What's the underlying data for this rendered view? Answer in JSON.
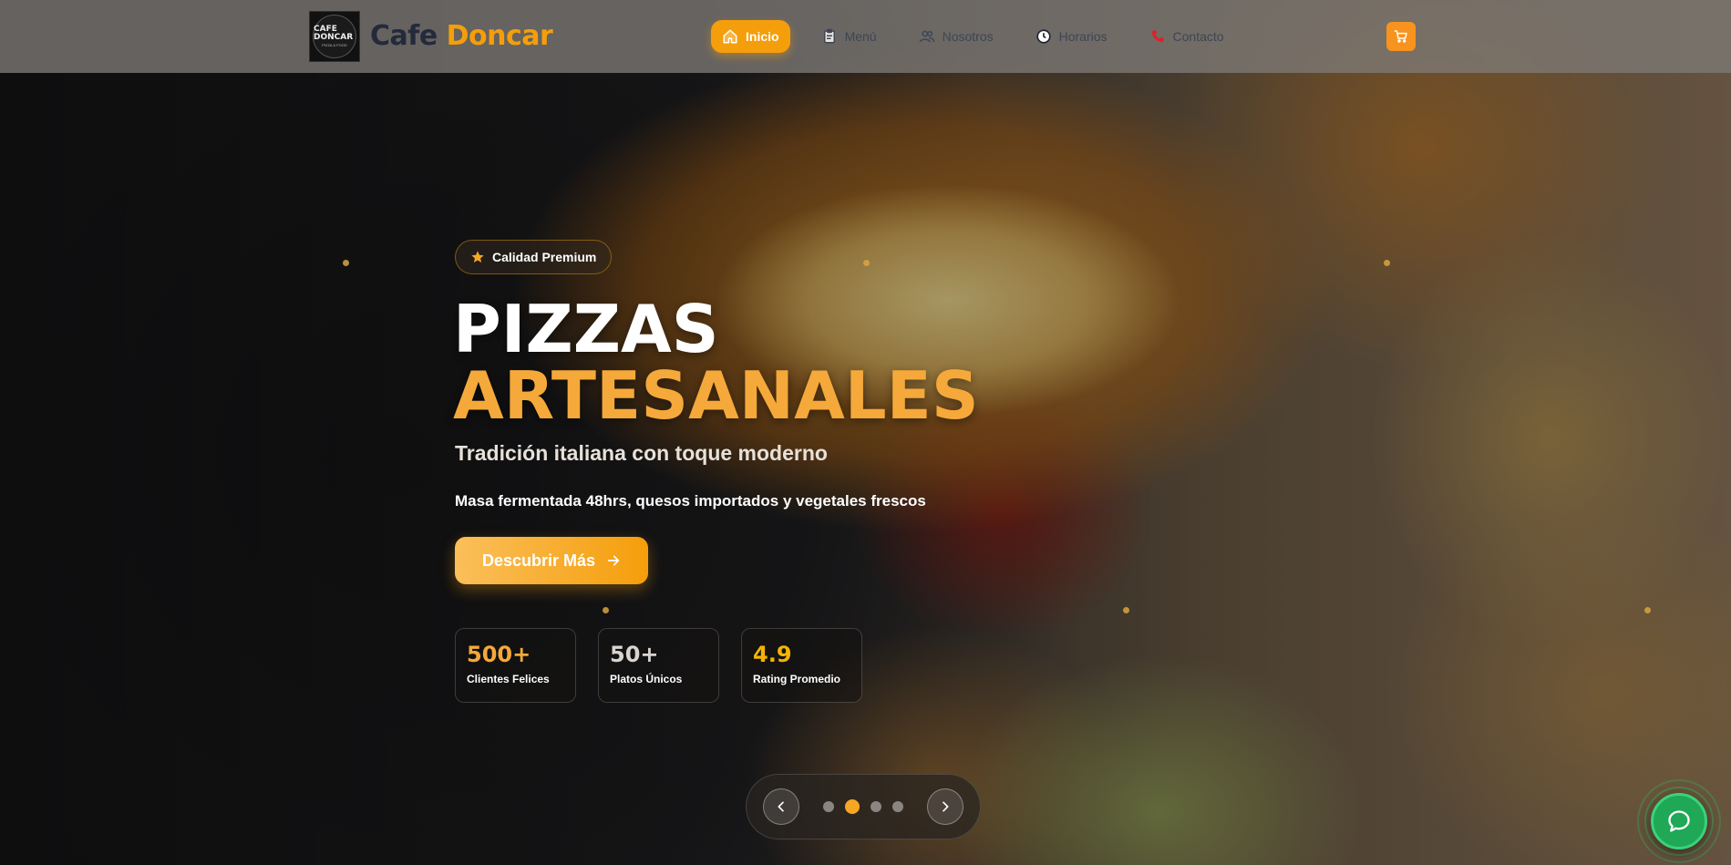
{
  "brand": {
    "logo_line1": "CAFE DONCAR",
    "logo_line2": "PIZZA & FOOD",
    "name_part1": "Cafe",
    "name_part2": "Doncar"
  },
  "nav": {
    "items": [
      {
        "label": "Inicio",
        "icon": "home-icon",
        "active": true
      },
      {
        "label": "Menú",
        "icon": "clipboard-icon",
        "active": false
      },
      {
        "label": "Nosotros",
        "icon": "users-icon",
        "active": false
      },
      {
        "label": "Horarios",
        "icon": "clock-icon",
        "active": false
      },
      {
        "label": "Contacto",
        "icon": "phone-icon",
        "active": false
      }
    ],
    "cart_icon": "cart-icon"
  },
  "hero": {
    "badge": "Calidad Premium",
    "title_line1": "PIZZAS",
    "title_line2": "ARTESANALES",
    "subtitle": "Tradición italiana con toque moderno",
    "description": "Masa fermentada 48hrs, quesos importados y vegetales frescos",
    "cta_label": "Descubrir Más",
    "stats": [
      {
        "value": "500+",
        "label": "Clientes Felices",
        "color": "#f5a93a"
      },
      {
        "value": "50+",
        "label": "Platos Únicos",
        "color": "#d8d4cf"
      },
      {
        "value": "4.9",
        "label": "Rating Promedio",
        "color": "#f5b400"
      }
    ]
  },
  "slider": {
    "total_slides": 4,
    "active_index": 1
  },
  "colors": {
    "accent": "#f59e0b",
    "brand_dark": "#232a3b",
    "whatsapp": "#1fa855"
  }
}
